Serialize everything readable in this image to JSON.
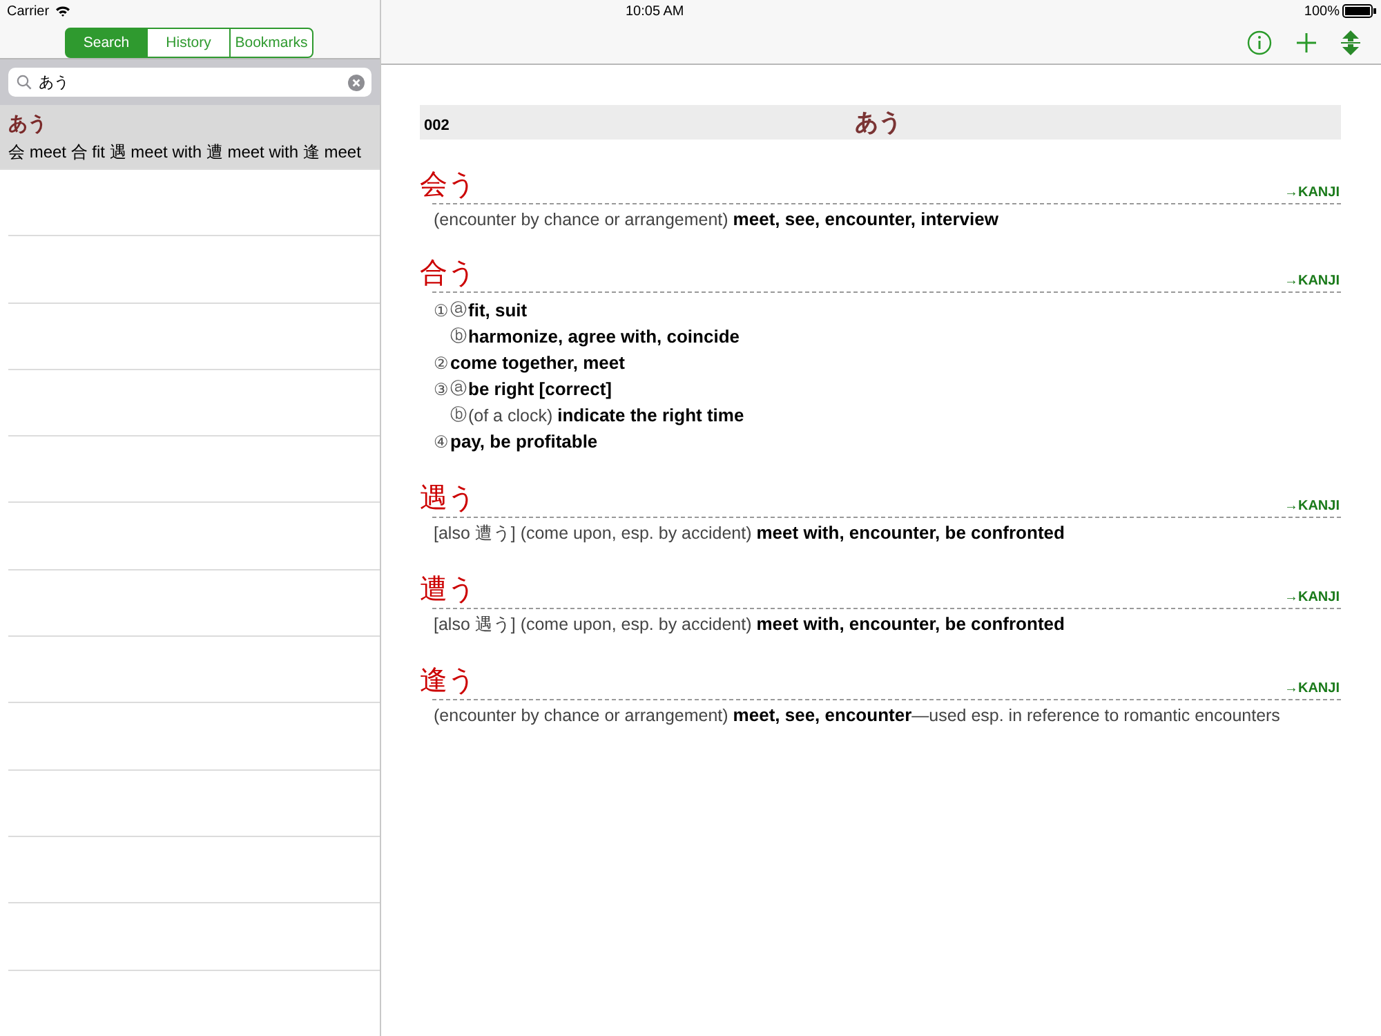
{
  "status_bar": {
    "carrier": "Carrier",
    "time": "10:05 AM",
    "battery": "100%"
  },
  "tabs": [
    {
      "label": "Search",
      "selected": true
    },
    {
      "label": "History",
      "selected": false
    },
    {
      "label": "Bookmarks",
      "selected": false
    }
  ],
  "search": {
    "value": "あう"
  },
  "results": [
    {
      "reading": "あう",
      "summary": "会 meet 合 fit 遇 meet with 遭 meet with 逢 meet",
      "selected": true
    }
  ],
  "entry_header": {
    "number": "002",
    "reading": "あう"
  },
  "entries": [
    {
      "headword": "会う",
      "link": "→KANJI",
      "definition": "(encounter by chance or arrangement) **meet, see, encounter, interview**"
    },
    {
      "headword": "合う",
      "link": "→KANJI",
      "senses": [
        {
          "number": "①",
          "subs": [
            {
              "letter": "ⓐ",
              "text": "**fit, suit**"
            },
            {
              "letter": "ⓑ",
              "text": "**harmonize, agree with, coincide**"
            }
          ]
        },
        {
          "number": "②",
          "text": "**come together, meet**"
        },
        {
          "number": "③",
          "subs": [
            {
              "letter": "ⓐ",
              "text": "**be right [correct]**"
            },
            {
              "letter": "ⓑ",
              "text": "(of a clock) **indicate the right time**"
            }
          ]
        },
        {
          "number": "④",
          "text": "**pay, be profitable**"
        }
      ]
    },
    {
      "headword": "遇う",
      "link": "→KANJI",
      "definition": "[also 遭う] (come upon, esp. by accident) **meet with, encounter, be confronted**"
    },
    {
      "headword": "遭う",
      "link": "→KANJI",
      "definition": "[also 遇う] (come upon, esp. by accident) **meet with, encounter, be confronted**"
    },
    {
      "headword": "逢う",
      "link": "→KANJI",
      "definition": "(encounter by chance or arrangement) **meet, see, encounter**—used esp. in reference to romantic encounters"
    }
  ]
}
